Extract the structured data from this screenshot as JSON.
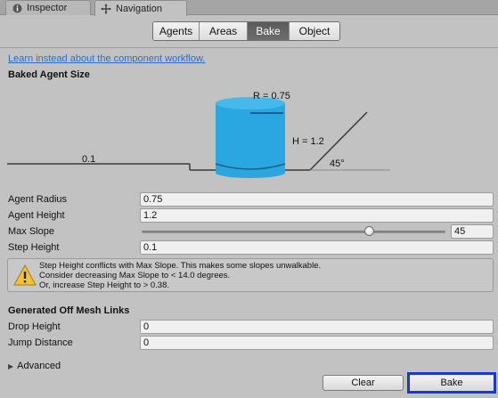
{
  "tabs": [
    {
      "label": "Inspector",
      "icon": "info-icon"
    },
    {
      "label": "Navigation",
      "icon": "navigation-icon"
    }
  ],
  "segments": [
    {
      "label": "Agents",
      "active": false
    },
    {
      "label": "Areas",
      "active": false
    },
    {
      "label": "Bake",
      "active": true
    },
    {
      "label": "Object",
      "active": false
    }
  ],
  "link_text": "Learn instead about the component workflow.",
  "baked_agent_size": {
    "title": "Baked Agent Size",
    "radius_label": "R = 0.75",
    "height_label": "H = 1.2",
    "step_label": "0.1",
    "slope_label": "45°"
  },
  "properties": {
    "agent_radius": {
      "label": "Agent Radius",
      "value": "0.75"
    },
    "agent_height": {
      "label": "Agent Height",
      "value": "1.2"
    },
    "max_slope": {
      "label": "Max Slope",
      "value": "45",
      "min": 0,
      "max": 60
    },
    "step_height": {
      "label": "Step Height",
      "value": "0.1"
    }
  },
  "warning": {
    "line1": "Step Height conflicts with Max Slope. This makes some slopes unwalkable.",
    "line2": "Consider decreasing Max Slope to < 14.0 degrees.",
    "line3": "Or, increase Step Height to > 0.38."
  },
  "off_mesh": {
    "title": "Generated Off Mesh Links",
    "drop_height": {
      "label": "Drop Height",
      "value": "0"
    },
    "jump_distance": {
      "label": "Jump Distance",
      "value": "0"
    }
  },
  "advanced_label": "Advanced",
  "buttons": {
    "clear": "Clear",
    "bake": "Bake"
  },
  "colors": {
    "accent": "#1a36d8",
    "cylinder": "#2aa7e0",
    "link": "#2a6ecf"
  }
}
